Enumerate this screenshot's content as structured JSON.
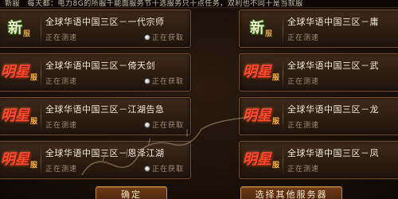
{
  "notice": "新服　每天都：电力8G的所服千能面服务节十选服务只十点任务，双利也不同十是当就服",
  "servers": [
    {
      "badge_main": "新",
      "badge_sub": "服",
      "badge_type": "new",
      "name": "全球华语中国三区－一代宗师",
      "status": "正在测速",
      "fetch": "正在获取"
    },
    {
      "badge_main": "新",
      "badge_sub": "服",
      "badge_type": "new",
      "name": "全球华语中国三区－庸",
      "status": "正在测速",
      "fetch": ""
    },
    {
      "badge_main": "明星",
      "badge_sub": "服",
      "badge_type": "star",
      "name": "全球华语中国三区－倚天剑",
      "status": "正在测速",
      "fetch": "正在获取"
    },
    {
      "badge_main": "明星",
      "badge_sub": "服",
      "badge_type": "star",
      "name": "全球华语中国三区－武",
      "status": "正在测速",
      "fetch": ""
    },
    {
      "badge_main": "明星",
      "badge_sub": "服",
      "badge_type": "star",
      "name": "全球华语中国三区－江湖告急",
      "status": "正在测速",
      "fetch": "正在获取"
    },
    {
      "badge_main": "明星",
      "badge_sub": "服",
      "badge_type": "star",
      "name": "全球华语中国三区－龙",
      "status": "正在测速",
      "fetch": ""
    },
    {
      "badge_main": "明星",
      "badge_sub": "服",
      "badge_type": "star",
      "name": "全球华语中国三区－恩泽江湖",
      "status": "正在测速",
      "fetch": "正在获取"
    },
    {
      "badge_main": "明星",
      "badge_sub": "服",
      "badge_type": "star",
      "name": "全球华语中国三区－凤",
      "status": "正在测速",
      "fetch": ""
    }
  ],
  "buttons": {
    "confirm": "确定",
    "choose": "选择其他服务器"
  },
  "colors": {
    "background": "#170e07",
    "card_border": "#6f4d2e",
    "new_badge_outline": "#3e6a1b",
    "star_badge": "#ff4a2a",
    "button_border": "#b98a3c"
  },
  "icons": {
    "fetch": "radio-dot-icon"
  }
}
